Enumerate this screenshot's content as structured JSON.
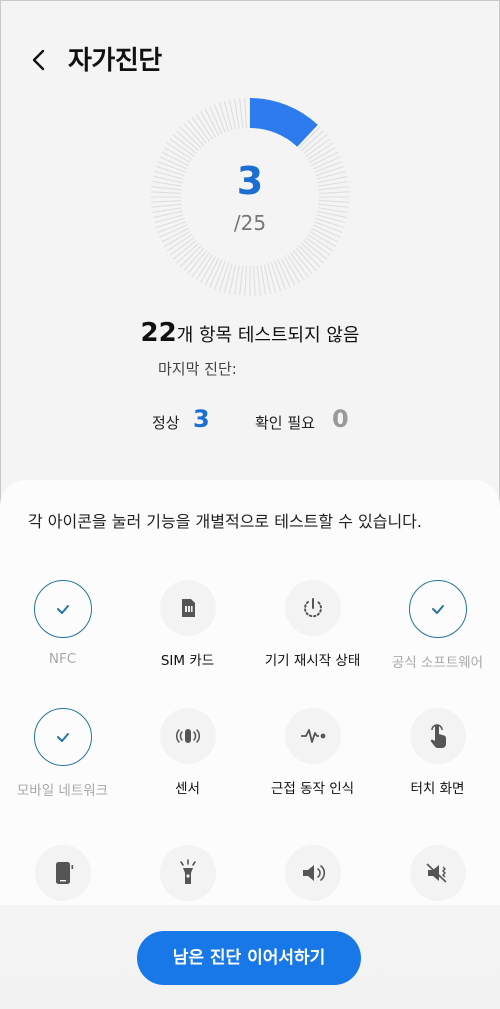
{
  "header": {
    "title": "자가진단",
    "back_icon": "back-arrow-icon"
  },
  "progress": {
    "passed": "3",
    "total_label": "/25",
    "fraction": 0.12,
    "accent": "#2e7bee"
  },
  "summary": {
    "count": "22",
    "text": "개 항목 테스트되지 않음",
    "last_diagnosis": "마지막 진단:"
  },
  "stats": {
    "normal_label": "정상",
    "normal_value": "3",
    "normal_color": "#1a6fd0",
    "check_label": "확인 필요",
    "check_value": "0",
    "check_color": "#9a9a9a"
  },
  "instructions": "각 아이콘을 눌러 기능을 개별적으로 테스트할 수 있습니다.",
  "items": [
    {
      "label": "NFC",
      "icon": "check-icon",
      "state": "done"
    },
    {
      "label": "SIM 카드",
      "icon": "sim-card-icon",
      "state": "pending"
    },
    {
      "label": "기기 재시작 상태",
      "icon": "restart-icon",
      "state": "pending"
    },
    {
      "label": "공식 소프트웨어",
      "icon": "check-icon",
      "state": "done"
    },
    {
      "label": "모바일 네트워크",
      "icon": "check-icon",
      "state": "done"
    },
    {
      "label": "센서",
      "icon": "sensor-icon",
      "state": "pending"
    },
    {
      "label": "근접 동작 인식",
      "icon": "proximity-icon",
      "state": "pending"
    },
    {
      "label": "터치 화면",
      "icon": "touch-icon",
      "state": "pending"
    },
    {
      "label": "",
      "icon": "phone-icon",
      "state": "pending"
    },
    {
      "label": "",
      "icon": "flashlight-icon",
      "state": "pending"
    },
    {
      "label": "",
      "icon": "speaker-icon",
      "state": "pending"
    },
    {
      "label": "",
      "icon": "vibration-icon",
      "state": "pending"
    }
  ],
  "cta": {
    "label": "남은 진단 이어서하기",
    "color": "#1878e8"
  }
}
